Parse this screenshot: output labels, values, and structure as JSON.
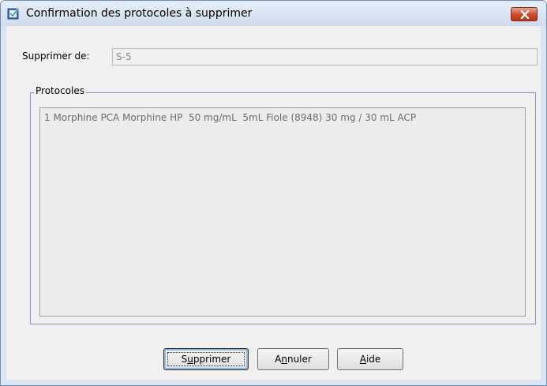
{
  "window": {
    "title": "Confirmation des protocoles à supprimer",
    "app_icon": "checkbox-icon",
    "close_icon": "close-icon"
  },
  "form": {
    "delete_from_label": "Supprimer de:",
    "delete_from_value": "S-5"
  },
  "protocols": {
    "group_label": "Protocoles",
    "items": [
      "1 Morphine PCA Morphine HP  50 mg/mL  5mL Fiole (8948) 30 mg / 30 mL ACP"
    ]
  },
  "buttons": {
    "delete": {
      "pre": "S",
      "mnemonic": "u",
      "post": "pprimer"
    },
    "cancel": {
      "pre": "A",
      "mnemonic": "n",
      "post": "nuler"
    },
    "help": {
      "pre": "",
      "mnemonic": "A",
      "post": "ide"
    }
  },
  "colors": {
    "title_bar": "#cfdcee",
    "close_button": "#c94a2c",
    "dialog_background": "#f0f0f0",
    "group_border": "#8a8cc0"
  }
}
